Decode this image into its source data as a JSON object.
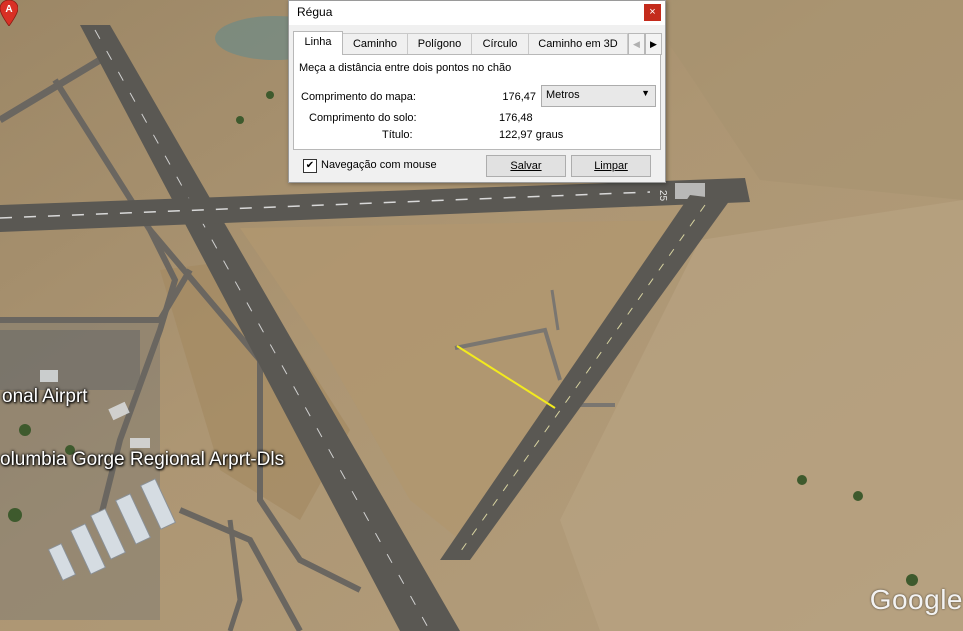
{
  "window": {
    "title": "Régua",
    "close_glyph": "×"
  },
  "tabs": [
    {
      "label": "Linha",
      "active": true
    },
    {
      "label": "Caminho",
      "active": false
    },
    {
      "label": "Polígono",
      "active": false
    },
    {
      "label": "Círculo",
      "active": false
    },
    {
      "label": "Caminho em 3D",
      "active": false
    }
  ],
  "tab_scroll": {
    "left_icon": "◀",
    "right_icon": "▶"
  },
  "panel": {
    "description": "Meça a distância entre dois pontos no chão",
    "map_length_label": "Comprimento do mapa:",
    "map_length_value": "176,47",
    "unit_selected": "Metros",
    "unit_arrow": "▼",
    "ground_length_label": "Comprimento do solo:",
    "ground_length_value": "176,48",
    "heading_label": "Título:",
    "heading_value": "122,97 graus"
  },
  "footer": {
    "mouse_nav_label": "Navegação com mouse",
    "mouse_nav_checked": true,
    "check_glyph": "✔",
    "save_label": "Salvar",
    "clear_label": "Limpar"
  },
  "map": {
    "labels": {
      "airport": "onal Airprt",
      "region": "olumbia Gorge Regional Arprt-Dls"
    },
    "pin_letter": "A",
    "runway_marking": "25",
    "watermark": "Google",
    "colors": {
      "terrain": "#a88f6a",
      "runway": "#5a5853",
      "measure_line": "#f2ea1e",
      "pin": "#d93025"
    }
  }
}
